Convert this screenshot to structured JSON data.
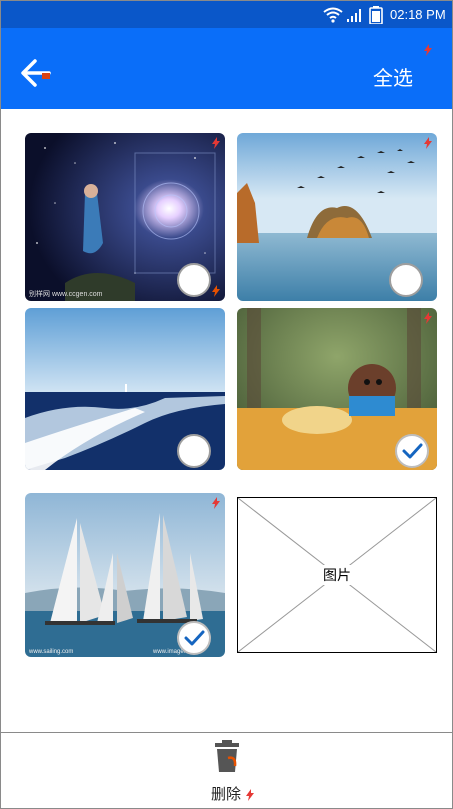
{
  "status_bar": {
    "time": "02:18 PM",
    "icons": [
      "wifi-icon",
      "signal-icon",
      "battery-icon"
    ]
  },
  "app_bar": {
    "back_icon": "back-arrow-icon",
    "select_all_label": "全选",
    "background_color": "#0a6ef9"
  },
  "photos": [
    {
      "id": "photo-1",
      "subject": "space-woman",
      "selected": false,
      "caption_left": "别样网 www.ccgen.com"
    },
    {
      "id": "photo-2",
      "subject": "lake-birds",
      "selected": false
    },
    {
      "id": "photo-3",
      "subject": "sea-wake",
      "selected": false
    },
    {
      "id": "photo-4",
      "subject": "puppy-leaves",
      "selected": true
    },
    {
      "id": "photo-5",
      "subject": "sailboats",
      "selected": true,
      "caption_left": "www.sailing.com",
      "caption_right": "www.image.com"
    }
  ],
  "placeholder": {
    "label": "图片"
  },
  "bottom_bar": {
    "delete_label": "删除",
    "delete_icon": "trash-icon"
  },
  "colors": {
    "status_bar": "#0a57c9",
    "app_bar": "#0a6ef9",
    "check_blue": "#1565c0"
  }
}
